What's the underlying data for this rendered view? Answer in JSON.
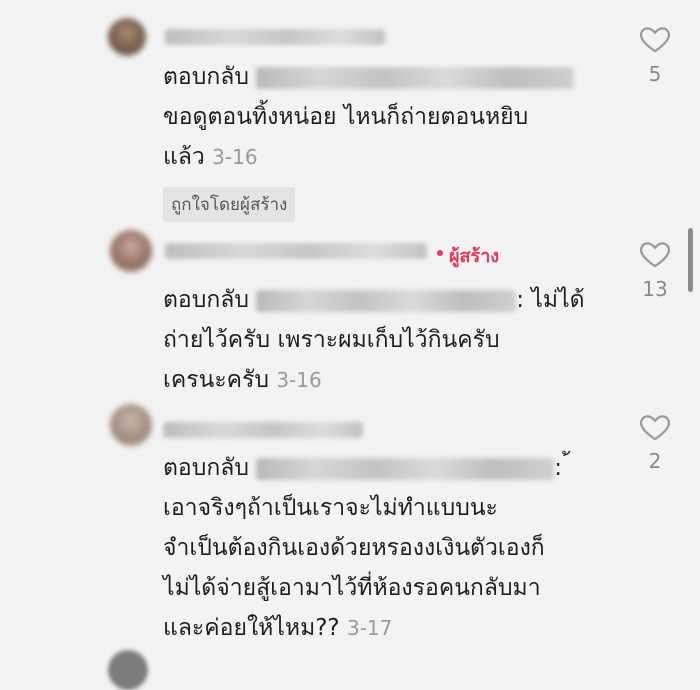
{
  "comments": [
    {
      "reply_prefix": "ตอบกลับ",
      "lines": [
        "ขอดูตอนทิ้งหน่อย  ไหนก็ถ่ายตอนหยิบ",
        "แล้ว"
      ],
      "date": "3-16",
      "liked_by_creator": "ถูกใจโดยผู้สร้าง",
      "like_count": "5"
    },
    {
      "creator_badge": "ผู้สร้าง",
      "reply_prefix": "ตอบกลับ",
      "reply_suffix": ": ไม่ได้",
      "lines": [
        "ถ่ายไว้ครับ เพราะผมเก็บไว้กินครับ",
        "เครนะครับ"
      ],
      "date": "3-16",
      "like_count": "13"
    },
    {
      "reply_prefix": "ตอบกลับ",
      "reply_suffix": ": ้",
      "lines": [
        "เอาจริงๆถ้าเป็นเราจะไม่ทำแบบนะ",
        "จำเป็นต้องกินเองด้วยหรองงเงินตัวเองก็",
        "ไม่ได้จ่ายสู้เอามาไว้ที่ห้องรอคนกลับมา",
        "และค่อยให้ไหม??"
      ],
      "date": "3-17",
      "like_count": "2"
    }
  ],
  "colors": {
    "creator_badge": "#e8385b",
    "date": "#9a9a9a",
    "like_count": "#8a8a8a"
  },
  "icons": {
    "like": "heart-outline-icon"
  }
}
